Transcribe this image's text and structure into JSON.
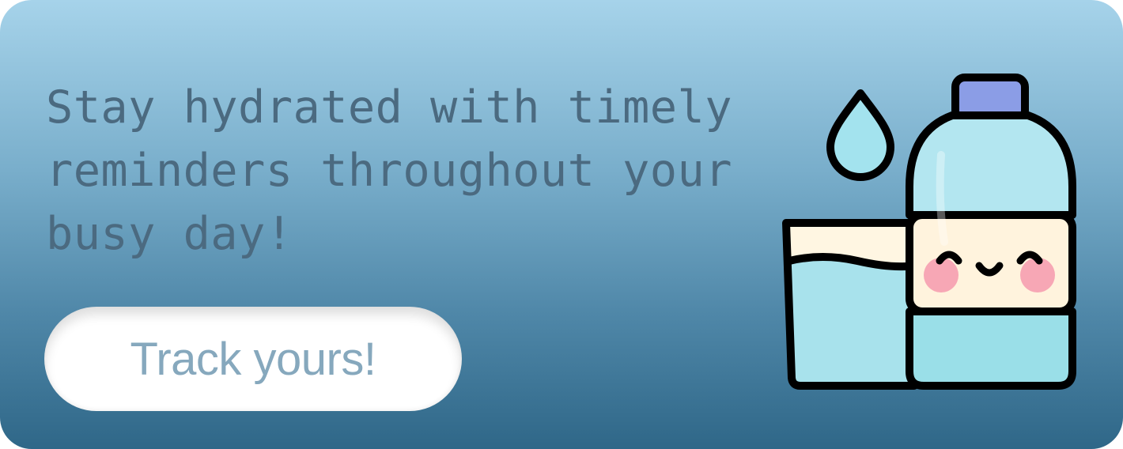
{
  "banner": {
    "headline": "Stay hydrated with timely reminders throughout your busy day!",
    "cta_label": "Track yours!"
  },
  "illustration": {
    "icons": [
      "water-drop-icon",
      "water-glass-icon",
      "water-bottle-icon"
    ]
  },
  "colors": {
    "gradient_top": "#a6d3ea",
    "gradient_bottom": "#2f6788",
    "headline_text": "#4b6a80",
    "button_bg": "#ffffff",
    "button_text": "#86a8bd",
    "water_light": "#b3e6f0",
    "water_mid": "#9adfe8",
    "label_cream": "#fff3dd",
    "cap_purple": "#8b9de6",
    "blush_pink": "#f7a7b5",
    "outline": "#000000"
  }
}
